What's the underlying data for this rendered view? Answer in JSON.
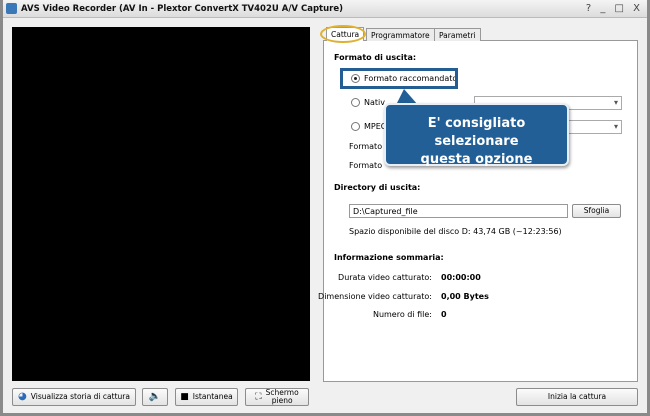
{
  "window": {
    "title": "AVS Video Recorder (AV In - Plextor ConvertX TV402U A/V Capture)",
    "controls": "? _ □ X"
  },
  "tabs": [
    {
      "label": "Cattura"
    },
    {
      "label": "Programmatore"
    },
    {
      "label": "Parametri"
    }
  ],
  "output_format": {
    "heading": "Formato di uscita:",
    "options": [
      {
        "label": "Formato raccomandato",
        "selected": true
      },
      {
        "label": "Nativ",
        "selected": false
      },
      {
        "label": "MPEG",
        "selected": false
      }
    ],
    "format_label_1": "Formato",
    "format_label_2": "Formato"
  },
  "callout": {
    "line1": "E' consigliato selezionare",
    "line2": "questa opzione"
  },
  "directory": {
    "heading": "Directory di uscita:",
    "path": "D:\\Captured_file",
    "browse": "Sfoglia",
    "free_space": "Spazio disponibile del disco D: 43,74 GB (~12:23:56)"
  },
  "summary": {
    "heading": "Informazione sommaria:",
    "rows": [
      {
        "label": "Durata video catturato:",
        "value": "00:00:00"
      },
      {
        "label": "Dimensione video catturato:",
        "value": "0,00 Bytes"
      },
      {
        "label": "Numero di file:",
        "value": "0"
      }
    ]
  },
  "buttons": {
    "history": "Visualizza storia di cattura",
    "snapshot": "Istantanea",
    "fullscreen_1": "Schermo",
    "fullscreen_2": "pieno",
    "start": "Inizia la cattura"
  }
}
